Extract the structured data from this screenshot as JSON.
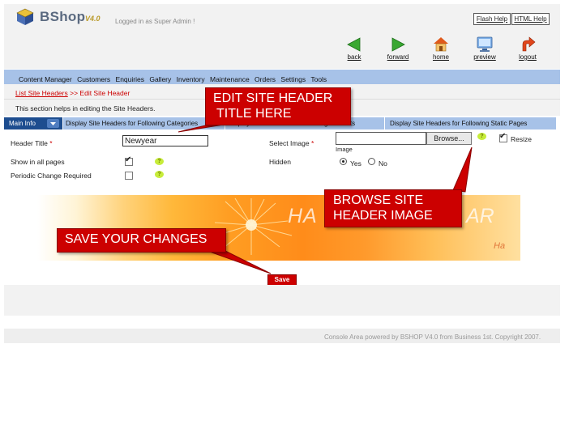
{
  "header": {
    "brand": "BShop",
    "version": "V4.0",
    "logged_in": "Logged in as Super Admin !",
    "flash_help": "Flash Help",
    "html_help": "HTML Help"
  },
  "nav": [
    {
      "label": "back",
      "icon": "arrow-left-icon"
    },
    {
      "label": "forward",
      "icon": "arrow-right-icon"
    },
    {
      "label": "home",
      "icon": "home-icon"
    },
    {
      "label": "preview",
      "icon": "monitor-icon"
    },
    {
      "label": "logout",
      "icon": "logout-arrow-icon"
    }
  ],
  "menu": [
    "Content Manager",
    "Customers",
    "Enquiries",
    "Gallery",
    "Inventory",
    "Maintenance",
    "Orders",
    "Settings",
    "Tools"
  ],
  "breadcrumb": {
    "link": "List Site Headers",
    "sep": ">>",
    "current": "Edit Site Header"
  },
  "description": "This section helps in editing the Site Headers.",
  "tabs": {
    "main": "Main Info",
    "cat": "Display Site Headers for Following Categories",
    "prod": "Display Site Headers for Following Products",
    "static": "Display Site Headers for Following Static Pages"
  },
  "form": {
    "header_title_label": "Header Title",
    "header_title_value": "Newyear",
    "show_all_label": "Show in all pages",
    "show_all_checked": true,
    "periodic_label": "Periodic Change Required",
    "periodic_checked": false,
    "select_image_label": "Select Image",
    "browse_label": "Browse...",
    "image_caption": "Image",
    "resize_label": "Resize",
    "resize_checked": true,
    "hidden_label": "Hidden",
    "yes_label": "Yes",
    "no_label": "No",
    "hidden_value": "Yes",
    "required_mark": "*",
    "help_mark": "?"
  },
  "banner": {
    "text_left": "HA",
    "text_right": "AR",
    "text_small": "Ha"
  },
  "callouts": {
    "edit_line1": "EDIT SITE HEADER",
    "edit_line2": "TITLE HERE",
    "browse_line1": "BROWSE SITE",
    "browse_line2": "HEADER IMAGE",
    "save": "SAVE YOUR CHANGES"
  },
  "save_label": "Save",
  "footer": "Console Area powered by BSHOP V4.0 from Business 1st. Copyright 2007.",
  "colors": {
    "accent_red": "#cc0000",
    "menu_blue": "#a7c2e8",
    "tab_dark_blue": "#1d4d8f",
    "help_green": "#c7ec3a"
  }
}
